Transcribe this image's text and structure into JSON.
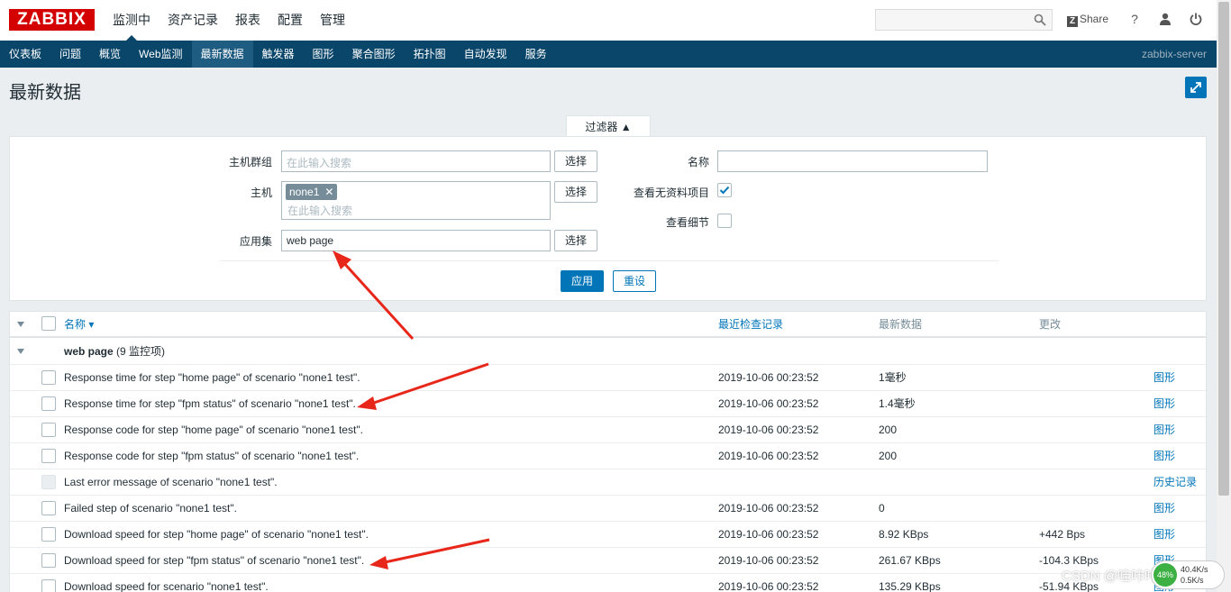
{
  "header": {
    "logo": "ZABBIX",
    "menu": [
      "监测中",
      "资产记录",
      "报表",
      "配置",
      "管理"
    ],
    "share": "Share",
    "help_glyph": "?"
  },
  "subnav": {
    "items": [
      "仪表板",
      "问题",
      "概览",
      "Web监测",
      "最新数据",
      "触发器",
      "图形",
      "聚合图形",
      "拓扑图",
      "自动发现",
      "服务"
    ],
    "server": "zabbix-server"
  },
  "page": {
    "title": "最新数据"
  },
  "filter": {
    "tab_label": "过滤器 ▲",
    "host_group_label": "主机群组",
    "host_group_placeholder": "在此输入搜索",
    "host_label": "主机",
    "host_tag": "none1",
    "host_placeholder": "在此输入搜索",
    "app_label": "应用集",
    "app_value": "web page",
    "select_label": "选择",
    "name_label": "名称",
    "name_value": "",
    "show_no_data_label": "查看无资料项目",
    "show_no_data_checked": true,
    "show_details_label": "查看细节",
    "show_details_checked": false,
    "apply_label": "应用",
    "reset_label": "重设"
  },
  "table": {
    "headers": {
      "name": "名称 ▾",
      "last_check": "最近检查记录",
      "last_value": "最新数据",
      "change": "更改"
    },
    "group": {
      "name": "web page",
      "count": "(9 监控项)"
    },
    "rows": [
      {
        "name": "Response time for step \"home page\" of scenario \"none1 test\".",
        "last_check": "2019-10-06 00:23:52",
        "last_value": "1毫秒",
        "change": "",
        "action": "图形",
        "disabled": false
      },
      {
        "name": "Response time for step \"fpm status\" of scenario \"none1 test\".",
        "last_check": "2019-10-06 00:23:52",
        "last_value": "1.4毫秒",
        "change": "",
        "action": "图形",
        "disabled": false
      },
      {
        "name": "Response code for step \"home page\" of scenario \"none1 test\".",
        "last_check": "2019-10-06 00:23:52",
        "last_value": "200",
        "change": "",
        "action": "图形",
        "disabled": false
      },
      {
        "name": "Response code for step \"fpm status\" of scenario \"none1 test\".",
        "last_check": "2019-10-06 00:23:52",
        "last_value": "200",
        "change": "",
        "action": "图形",
        "disabled": false
      },
      {
        "name": "Last error message of scenario \"none1 test\".",
        "last_check": "",
        "last_value": "",
        "change": "",
        "action": "历史记录",
        "disabled": true
      },
      {
        "name": "Failed step of scenario \"none1 test\".",
        "last_check": "2019-10-06 00:23:52",
        "last_value": "0",
        "change": "",
        "action": "图形",
        "disabled": false
      },
      {
        "name": "Download speed for step \"home page\" of scenario \"none1 test\".",
        "last_check": "2019-10-06 00:23:52",
        "last_value": "8.92 KBps",
        "change": "+442 Bps",
        "action": "图形",
        "disabled": false
      },
      {
        "name": "Download speed for step \"fpm status\" of scenario \"none1 test\".",
        "last_check": "2019-10-06 00:23:52",
        "last_value": "261.67 KBps",
        "change": "-104.3 KBps",
        "action": "图形",
        "disabled": false
      },
      {
        "name": "Download speed for scenario \"none1 test\".",
        "last_check": "2019-10-06 00:23:52",
        "last_value": "135.29 KBps",
        "change": "-51.94 KBps",
        "action": "图形",
        "disabled": false
      }
    ]
  },
  "overlay": {
    "watermark": "CSDN @哇咔咔明善",
    "net_percent": "48%",
    "net_up": "40.4K/s",
    "net_down": "0.5K/s"
  },
  "colors": {
    "brand": "#d40000",
    "nav": "#0a466a",
    "accent": "#0275b8",
    "arrow": "#e8271b"
  }
}
